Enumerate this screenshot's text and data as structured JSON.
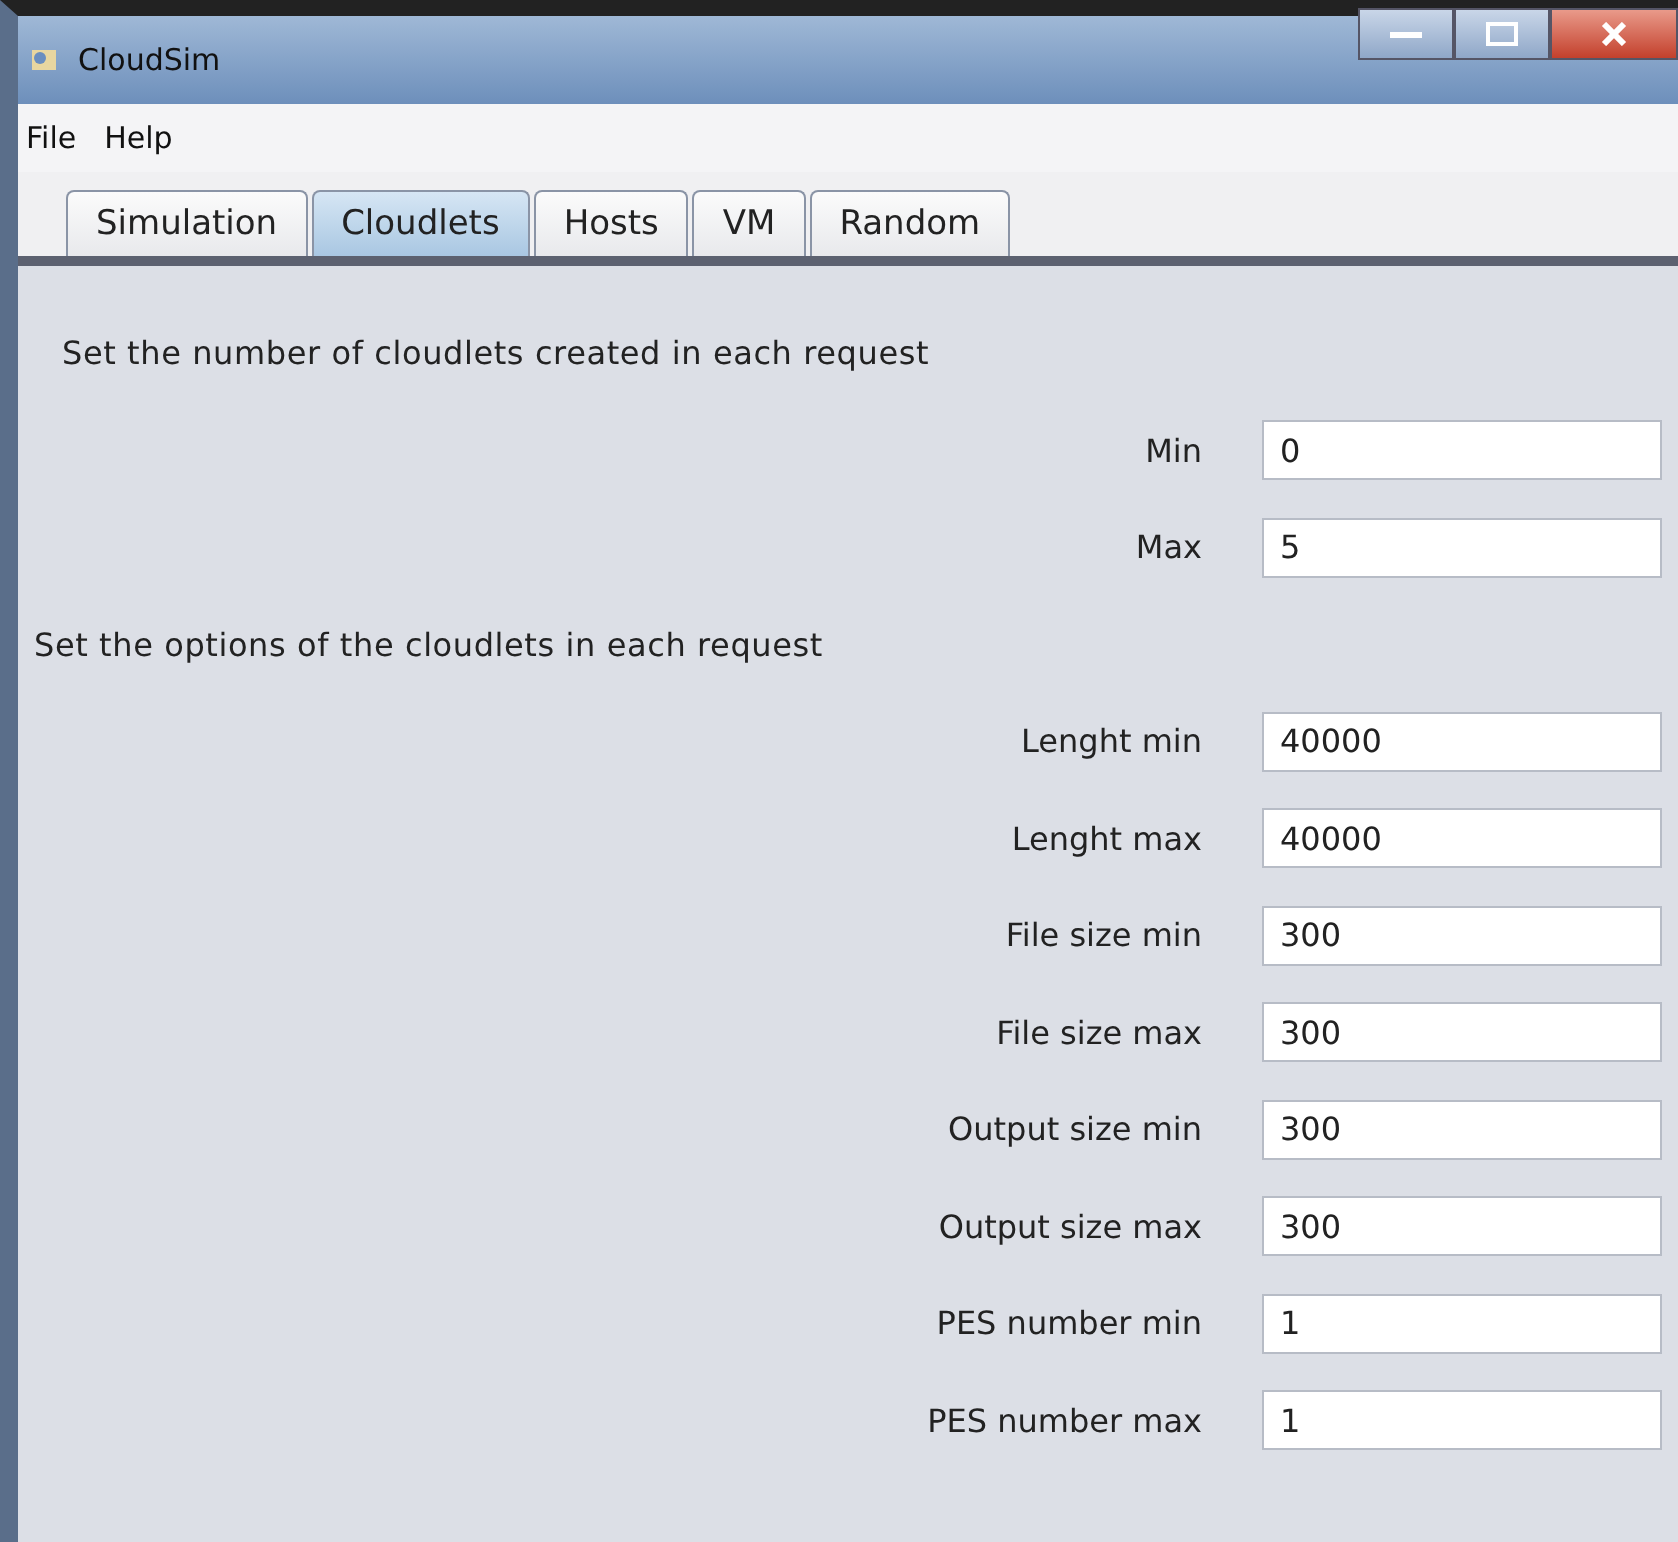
{
  "window": {
    "title": "CloudSim"
  },
  "menu": [
    "File",
    "Help"
  ],
  "tabs": [
    {
      "label": "Simulation",
      "selected": false
    },
    {
      "label": "Cloudlets",
      "selected": true
    },
    {
      "label": "Hosts",
      "selected": false
    },
    {
      "label": "VM",
      "selected": false
    },
    {
      "label": "Random",
      "selected": false
    }
  ],
  "sections": [
    {
      "heading": "Set the number of cloudlets created in each request",
      "fields": [
        {
          "label": "Min",
          "value": "0"
        },
        {
          "label": "Max",
          "value": "5"
        }
      ]
    },
    {
      "heading": "Set the options of the cloudlets in each request",
      "fields": [
        {
          "label": "Lenght min",
          "value": "40000"
        },
        {
          "label": "Lenght max",
          "value": "40000"
        },
        {
          "label": "File size min",
          "value": "300"
        },
        {
          "label": "File size max",
          "value": "300"
        },
        {
          "label": "Output size min",
          "value": "300"
        },
        {
          "label": "Output size max",
          "value": "300"
        },
        {
          "label": "PES number min",
          "value": "1"
        },
        {
          "label": "PES number max",
          "value": "1"
        }
      ]
    }
  ]
}
